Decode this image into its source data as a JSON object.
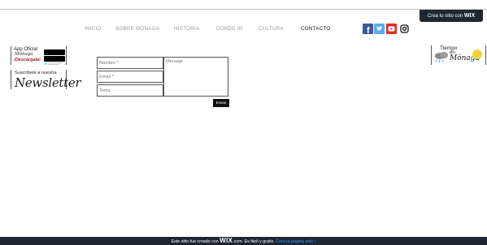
{
  "wix_badge": {
    "text": "Crea tu sitio con",
    "brand": "WIX"
  },
  "nav": {
    "items": [
      {
        "label": "INICIO",
        "active": false
      },
      {
        "label": "SOBRE MÓNAGA",
        "active": false
      },
      {
        "label": "HISTORIA",
        "active": false
      },
      {
        "label": "DÓNDE IR",
        "active": false
      },
      {
        "label": "CULTURA",
        "active": false
      },
      {
        "label": "CONTACTO",
        "active": true
      }
    ]
  },
  "social": {
    "icons": [
      "facebook-icon",
      "twitter-icon",
      "youtube-icon",
      "instagram-icon"
    ],
    "colors": {
      "facebook": "#3b5998",
      "twitter": "#55acee",
      "youtube": "#e52d27",
      "instagram": "#111111"
    }
  },
  "app_promo": {
    "line1": "App Oficial",
    "line2": "Mónaga",
    "line3": "¡Descárgala!"
  },
  "newsletter": {
    "line1": "Suscríbete a nuestra",
    "line2": "Newsletter"
  },
  "weather": {
    "line1": "Tiempo",
    "line2": "en",
    "line3": "Mónaga"
  },
  "form": {
    "name_placeholder": "Nombre *",
    "email_placeholder": "Email *",
    "subject_placeholder": "Tema",
    "message_placeholder": "Mensaje",
    "submit_label": "Enviar"
  },
  "footer": {
    "text_before": "Este sitio fue creado con",
    "brand": "WIX",
    "text_after": ".com. Es fácil y gratis.",
    "cta": "Crea tu página web ›"
  },
  "colors": {
    "dark_bar": "#1e2632",
    "link_blue": "#3899ec",
    "nav_inactive": "#9a9a9a",
    "nav_active": "#111111"
  }
}
